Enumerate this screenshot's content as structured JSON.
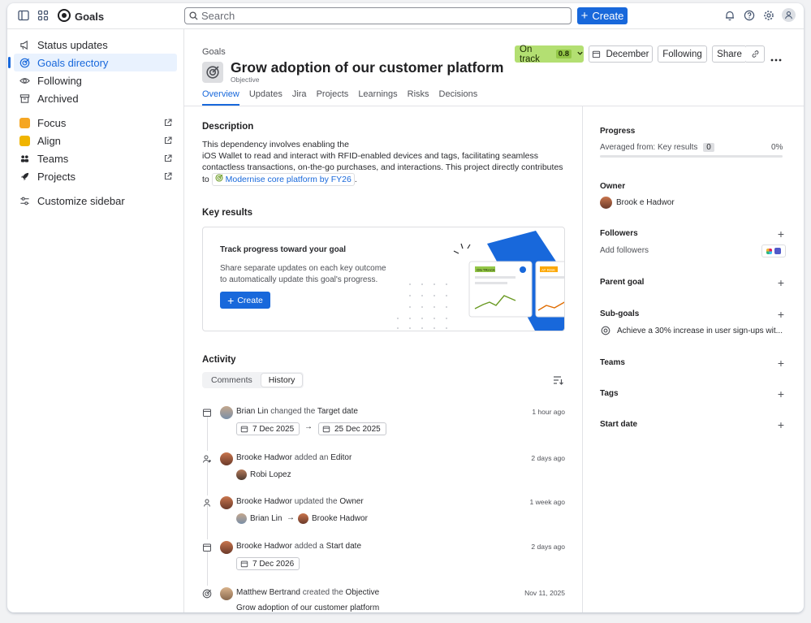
{
  "topbar": {
    "app_name": "Goals",
    "search_placeholder": "Search",
    "create_label": "Create"
  },
  "sidebar": {
    "items": [
      {
        "label": "Status updates",
        "icon": "megaphone-icon"
      },
      {
        "label": "Goals directory",
        "icon": "goal-target-icon"
      },
      {
        "label": "Following",
        "icon": "eye-icon"
      },
      {
        "label": "Archived",
        "icon": "archive-icon"
      }
    ],
    "apps": [
      {
        "label": "Focus",
        "color": "#f5a623"
      },
      {
        "label": "Align",
        "color": "#f0b400"
      },
      {
        "label": "Teams",
        "color": "#292a2e"
      },
      {
        "label": "Projects",
        "color": "#292a2e"
      }
    ],
    "customize_label": "Customize sidebar"
  },
  "header": {
    "breadcrumb": "Goals",
    "title": "Grow adoption of our customer platform",
    "subtitle": "Objective",
    "status_label": "On track",
    "status_score": "0.8",
    "date_label": "December",
    "following_label": "Following",
    "share_label": "Share",
    "tabs": [
      "Overview",
      "Updates",
      "Jira",
      "Projects",
      "Learnings",
      "Risks",
      "Decisions"
    ]
  },
  "description": {
    "heading": "Description",
    "line1": "This dependency involves enabling the",
    "line2": "iOS Wallet to read and interact with RFID-enabled devices and tags, facilitating seamless",
    "line3": "contactless transactions, on-the-go purchases, and interactions. This project directly contributes",
    "line4_prefix": "to",
    "link": "Modernise core platform by FY26",
    "line4_suffix": "."
  },
  "key_results": {
    "heading": "Key results",
    "card_title": "Track progress toward your goal",
    "card_text_1": "Share separate updates on each key outcome",
    "card_text_2": "to automatically update this goal's progress.",
    "create_label": "Create",
    "illustration_tag_1": "ON TRACK",
    "illustration_tag_2": "AT RISK"
  },
  "activity": {
    "heading": "Activity",
    "tabs": [
      "Comments",
      "History"
    ],
    "entries": [
      {
        "user": "Brian Lin",
        "action": "changed the",
        "target": "Target date",
        "time": "1 hour ago",
        "from": "7 Dec 2025",
        "to": "25 Dec 2025"
      },
      {
        "user": "Brooke Hadwor",
        "action": "added an",
        "target": "Editor",
        "time": "2 days ago",
        "person": "Robi Lopez"
      },
      {
        "user": "Brooke Hadwor",
        "action": "updated the",
        "target": "Owner",
        "time": "1 week ago",
        "from_person": "Brian Lin",
        "to_person": "Brooke Hadwor"
      },
      {
        "user": "Brooke Hadwor",
        "action": "added a",
        "target": "Start date",
        "time": "2 days ago",
        "date": "7 Dec 2026"
      },
      {
        "user": "Matthew Bertrand",
        "action": "created the",
        "target": "Objective",
        "time": "Nov 11, 2025",
        "detail": "Grow adoption of our customer platform"
      }
    ]
  },
  "details": {
    "progress_heading": "Progress",
    "progress_text": "Averaged from: Key results",
    "progress_count": "0",
    "progress_percent": "0%",
    "progress_value": 0,
    "owner_heading": "Owner",
    "owner_name": "Brook e Hadwor",
    "followers_heading": "Followers",
    "add_followers": "Add followers",
    "parent_goal_heading": "Parent goal",
    "subgoals_heading": "Sub-goals",
    "subgoal_text": "Achieve a 30% increase in user sign-ups wit...",
    "teams_heading": "Teams",
    "tags_heading": "Tags",
    "start_date_heading": "Start date"
  },
  "colors": {
    "accent": "#1868db",
    "on_track": "#b3df72",
    "border": "#dddee1"
  }
}
